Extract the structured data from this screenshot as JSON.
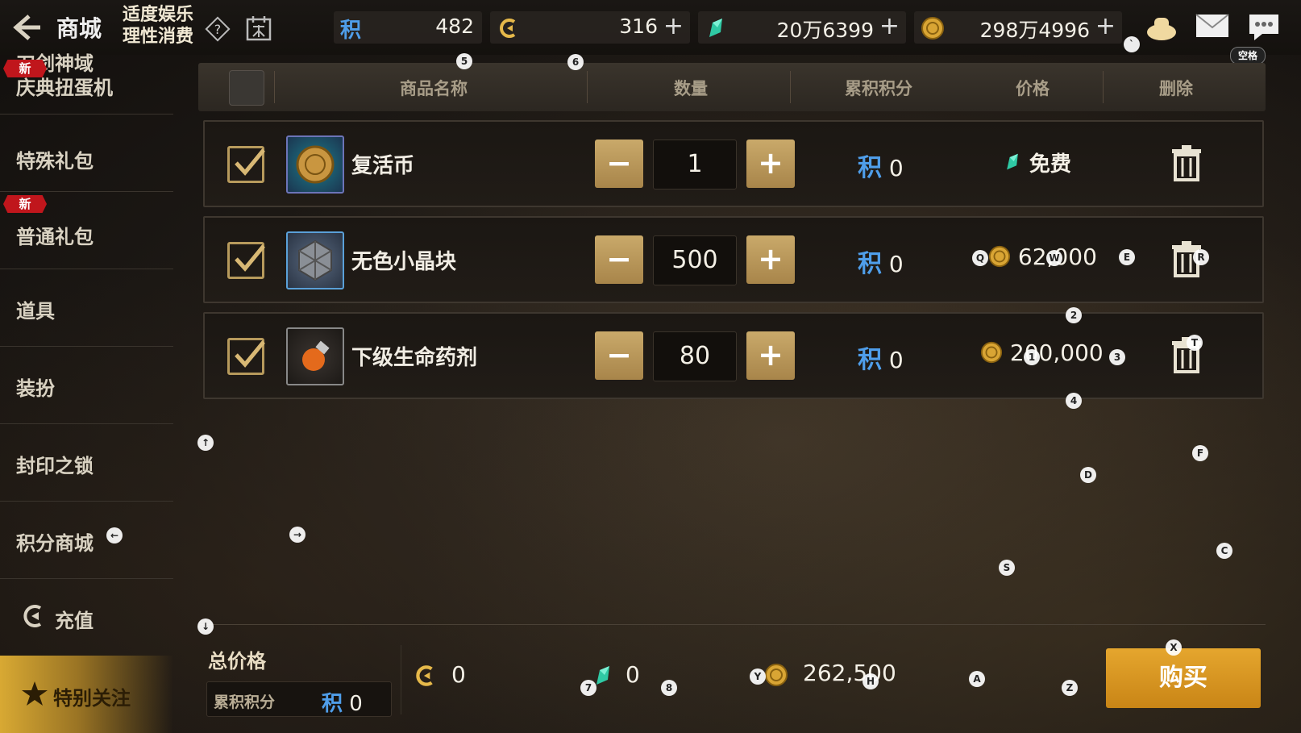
{
  "topbar": {
    "title": "商城",
    "motto_line1": "适度娱乐",
    "motto_line2": "理性消费",
    "points_symbol": "积",
    "points_value": "482",
    "coupon_value": "316",
    "crystal_value": "20万6399",
    "gold_value": "298万4996",
    "plus": "+",
    "space_label": "空格"
  },
  "sidebar": {
    "items": [
      {
        "label_line1": "刀剑神域",
        "label_line2": "庆典扭蛋机"
      },
      {
        "label": "特殊礼包",
        "badge": "新"
      },
      {
        "label": "普通礼包",
        "badge": "新"
      },
      {
        "label": "道具"
      },
      {
        "label": "装扮"
      },
      {
        "label": "封印之锁"
      },
      {
        "label": "积分商城"
      },
      {
        "label": "充值"
      }
    ],
    "special": "特别关注"
  },
  "table": {
    "headers": [
      "商品名称",
      "数量",
      "累积积分",
      "价格",
      "删除"
    ],
    "rows": [
      {
        "name": "复活币",
        "qty": "1",
        "points_symbol": "积",
        "points": "0",
        "price": "免费",
        "currency": "crystal"
      },
      {
        "name": "无色小晶块",
        "qty": "500",
        "points_symbol": "积",
        "points": "0",
        "price": "62,000",
        "currency": "gold"
      },
      {
        "name": "下级生命药剂",
        "qty": "80",
        "points_symbol": "积",
        "points": "0",
        "price": "200,000",
        "currency": "gold"
      }
    ],
    "minus": "−",
    "plus": "+"
  },
  "footer": {
    "total_label": "总价格",
    "accum_label": "累积积分",
    "accum_symbol": "积",
    "accum_value": "0",
    "coupon_total": "0",
    "crystal_total": "0",
    "gold_total": "262,500",
    "buy_label": "购买"
  },
  "markers": [
    "5",
    "6",
    "`",
    "Q",
    "W",
    "E",
    "R",
    "2",
    "1",
    "3",
    "T",
    "4",
    "↑",
    "F",
    "D",
    "→",
    "C",
    "S",
    "↓",
    "X",
    "7",
    "8",
    "Y",
    "H",
    "A",
    "Z",
    "←"
  ],
  "colors": {
    "accent_gold": "#c98516",
    "points_blue": "#4f9eea",
    "badge_red": "#c0161c"
  }
}
